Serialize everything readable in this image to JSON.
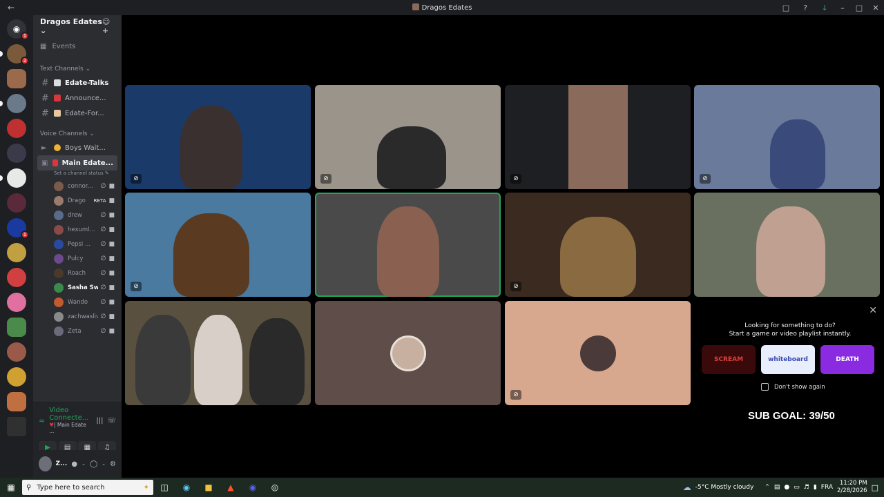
{
  "window": {
    "title": "Dragos Edates"
  },
  "server": {
    "name": "Dragos Edates",
    "events_label": "Events"
  },
  "text_channels": {
    "header": "Text Channels",
    "items": [
      {
        "label": "Edate-Talks"
      },
      {
        "label": "Announce..."
      },
      {
        "label": "Edate-For..."
      }
    ]
  },
  "voice_channels": {
    "header": "Voice Channels",
    "items": [
      {
        "label": "Boys Wait..."
      },
      {
        "label": "Main Edate..."
      }
    ],
    "status_placeholder": "Set a channel status",
    "users": [
      {
        "name": "connor...",
        "color": "#7a5a4a"
      },
      {
        "name": "Drago",
        "color": "#9a7a6a",
        "tag": "RETA"
      },
      {
        "name": "drew",
        "color": "#5a6a8a"
      },
      {
        "name": "hexuml...",
        "color": "#8a4a4a"
      },
      {
        "name": "Pepsi ...",
        "color": "#2a4aa0"
      },
      {
        "name": "Pulcy",
        "color": "#6a4a8a"
      },
      {
        "name": "Roach",
        "color": "#4a3a2a"
      },
      {
        "name": "Sasha Swan",
        "color": "#3a8a4a"
      },
      {
        "name": "Wando",
        "color": "#c05a30"
      },
      {
        "name": "zachwaslive",
        "color": "#8a8a8a"
      },
      {
        "name": "Zeta",
        "color": "#6a6a7a"
      }
    ]
  },
  "voice_panel": {
    "title": "Video Connecte...",
    "subtitle": "| Main Edate ..."
  },
  "user_panel": {
    "name": "Z..."
  },
  "promo": {
    "line1": "Looking for something to do?",
    "line2": "Start a game or video playlist instantly.",
    "games": [
      {
        "label": "SCREAM",
        "color": "#3a0a0a"
      },
      {
        "label": "whiteboard",
        "color": "#e8eefc"
      },
      {
        "label": "DEATH",
        "color": "#8a2be2"
      }
    ],
    "dont_show": "Don't show again"
  },
  "overlay": {
    "sub_goal": "SUB GOAL: 39/50"
  },
  "taskbar": {
    "search_placeholder": "Type here to search",
    "weather": "-5°C  Mostly cloudy",
    "lang": "FRA",
    "time": "11:20 PM",
    "date": "2/28/2026"
  },
  "colors": {
    "accent_green": "#23a55a",
    "blurple": "#5865f2"
  }
}
